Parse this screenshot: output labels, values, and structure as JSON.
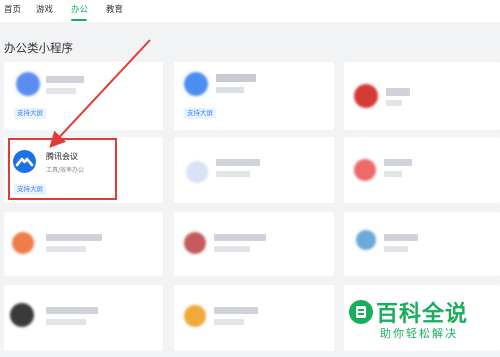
{
  "nav": {
    "tabs": [
      {
        "label": "首页"
      },
      {
        "label": "游戏"
      },
      {
        "label": "办公",
        "active": true
      },
      {
        "label": "教育"
      }
    ]
  },
  "section": {
    "title": "办公类小程序"
  },
  "cards": [
    {
      "id": "card-1",
      "badge": "支持大屏"
    },
    {
      "id": "card-2",
      "badge": "支持大屏"
    },
    {
      "id": "card-tencent-meeting",
      "title": "腾讯会议",
      "subtitle": "工具/效率办公",
      "badge": "支持大屏"
    }
  ],
  "watermark": {
    "title": "百科全说",
    "subtitle": "助你轻松解决"
  },
  "colors": {
    "accent": "#1aad5c",
    "highlight": "#e23b33",
    "badge_text": "#3a86ff"
  },
  "icons": {
    "tencent_meeting": "tencent-meeting-logo-icon",
    "watermark_logo": "baike-logo-icon"
  }
}
